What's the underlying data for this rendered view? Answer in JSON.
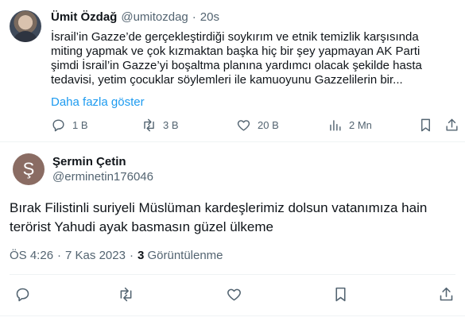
{
  "quoted_tweet": {
    "author_name": "Ümit Özdağ",
    "author_handle": "@umitozdag",
    "separator": "·",
    "time": "20s",
    "text": "İsrail’in Gazze’de gerçekleştirdiği soykırım ve etnik temizlik karşısında\nmiting yapmak ve çok kızmaktan başka hiç bir şey yapmayan AK Parti\nşimdi İsrail’in Gazze’yi boşaltma planına yardımcı olacak şekilde hasta\ntedavisi, yetim çocuklar söylemleri ile kamuoyunu Gazzelilerin bir...",
    "show_more": "Daha fazla göster",
    "stats": {
      "replies": "1 B",
      "retweets": "3 B",
      "likes": "20 B",
      "views": "2 Mn"
    },
    "icons": [
      "reply-icon",
      "retweet-icon",
      "like-icon",
      "views-icon",
      "bookmark-icon",
      "share-icon"
    ]
  },
  "reply_tweet": {
    "avatar_letter": "Ş",
    "author_name": "Şermin Çetin",
    "author_handle": "@erminetin176046",
    "text": "Bırak Filistinli suriyeli  Müslüman kardeşlerimiz dolsun vatanımıza hain\nterörist  Yahudi ayak basmasın güzel ülkeme",
    "time": "ÖS 4:26",
    "separator": "·",
    "date": "7 Kas 2023",
    "views_count": "3",
    "views_label": "Görüntülenme",
    "icons": [
      "reply-icon",
      "retweet-icon",
      "like-icon",
      "bookmark-icon",
      "share-icon"
    ]
  },
  "colors": {
    "accent": "#1d9bf0",
    "text": "#0f1419",
    "muted": "#536471",
    "divider": "#eff3f4"
  }
}
